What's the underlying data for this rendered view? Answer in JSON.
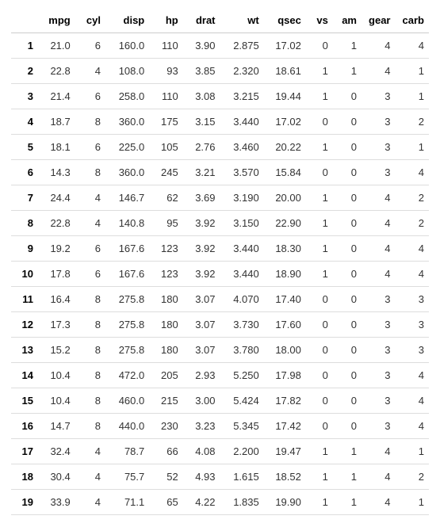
{
  "chart_data": {
    "type": "table",
    "title": "",
    "columns": [
      "mpg",
      "cyl",
      "disp",
      "hp",
      "drat",
      "wt",
      "qsec",
      "vs",
      "am",
      "gear",
      "carb"
    ],
    "index": [
      "1",
      "2",
      "3",
      "4",
      "5",
      "6",
      "7",
      "8",
      "9",
      "10",
      "11",
      "12",
      "13",
      "14",
      "15",
      "16",
      "17",
      "18",
      "19"
    ],
    "rows": [
      {
        "mpg": "21.0",
        "cyl": "6",
        "disp": "160.0",
        "hp": "110",
        "drat": "3.90",
        "wt": "2.875",
        "qsec": "17.02",
        "vs": "0",
        "am": "1",
        "gear": "4",
        "carb": "4"
      },
      {
        "mpg": "22.8",
        "cyl": "4",
        "disp": "108.0",
        "hp": "93",
        "drat": "3.85",
        "wt": "2.320",
        "qsec": "18.61",
        "vs": "1",
        "am": "1",
        "gear": "4",
        "carb": "1"
      },
      {
        "mpg": "21.4",
        "cyl": "6",
        "disp": "258.0",
        "hp": "110",
        "drat": "3.08",
        "wt": "3.215",
        "qsec": "19.44",
        "vs": "1",
        "am": "0",
        "gear": "3",
        "carb": "1"
      },
      {
        "mpg": "18.7",
        "cyl": "8",
        "disp": "360.0",
        "hp": "175",
        "drat": "3.15",
        "wt": "3.440",
        "qsec": "17.02",
        "vs": "0",
        "am": "0",
        "gear": "3",
        "carb": "2"
      },
      {
        "mpg": "18.1",
        "cyl": "6",
        "disp": "225.0",
        "hp": "105",
        "drat": "2.76",
        "wt": "3.460",
        "qsec": "20.22",
        "vs": "1",
        "am": "0",
        "gear": "3",
        "carb": "1"
      },
      {
        "mpg": "14.3",
        "cyl": "8",
        "disp": "360.0",
        "hp": "245",
        "drat": "3.21",
        "wt": "3.570",
        "qsec": "15.84",
        "vs": "0",
        "am": "0",
        "gear": "3",
        "carb": "4"
      },
      {
        "mpg": "24.4",
        "cyl": "4",
        "disp": "146.7",
        "hp": "62",
        "drat": "3.69",
        "wt": "3.190",
        "qsec": "20.00",
        "vs": "1",
        "am": "0",
        "gear": "4",
        "carb": "2"
      },
      {
        "mpg": "22.8",
        "cyl": "4",
        "disp": "140.8",
        "hp": "95",
        "drat": "3.92",
        "wt": "3.150",
        "qsec": "22.90",
        "vs": "1",
        "am": "0",
        "gear": "4",
        "carb": "2"
      },
      {
        "mpg": "19.2",
        "cyl": "6",
        "disp": "167.6",
        "hp": "123",
        "drat": "3.92",
        "wt": "3.440",
        "qsec": "18.30",
        "vs": "1",
        "am": "0",
        "gear": "4",
        "carb": "4"
      },
      {
        "mpg": "17.8",
        "cyl": "6",
        "disp": "167.6",
        "hp": "123",
        "drat": "3.92",
        "wt": "3.440",
        "qsec": "18.90",
        "vs": "1",
        "am": "0",
        "gear": "4",
        "carb": "4"
      },
      {
        "mpg": "16.4",
        "cyl": "8",
        "disp": "275.8",
        "hp": "180",
        "drat": "3.07",
        "wt": "4.070",
        "qsec": "17.40",
        "vs": "0",
        "am": "0",
        "gear": "3",
        "carb": "3"
      },
      {
        "mpg": "17.3",
        "cyl": "8",
        "disp": "275.8",
        "hp": "180",
        "drat": "3.07",
        "wt": "3.730",
        "qsec": "17.60",
        "vs": "0",
        "am": "0",
        "gear": "3",
        "carb": "3"
      },
      {
        "mpg": "15.2",
        "cyl": "8",
        "disp": "275.8",
        "hp": "180",
        "drat": "3.07",
        "wt": "3.780",
        "qsec": "18.00",
        "vs": "0",
        "am": "0",
        "gear": "3",
        "carb": "3"
      },
      {
        "mpg": "10.4",
        "cyl": "8",
        "disp": "472.0",
        "hp": "205",
        "drat": "2.93",
        "wt": "5.250",
        "qsec": "17.98",
        "vs": "0",
        "am": "0",
        "gear": "3",
        "carb": "4"
      },
      {
        "mpg": "10.4",
        "cyl": "8",
        "disp": "460.0",
        "hp": "215",
        "drat": "3.00",
        "wt": "5.424",
        "qsec": "17.82",
        "vs": "0",
        "am": "0",
        "gear": "3",
        "carb": "4"
      },
      {
        "mpg": "14.7",
        "cyl": "8",
        "disp": "440.0",
        "hp": "230",
        "drat": "3.23",
        "wt": "5.345",
        "qsec": "17.42",
        "vs": "0",
        "am": "0",
        "gear": "3",
        "carb": "4"
      },
      {
        "mpg": "32.4",
        "cyl": "4",
        "disp": "78.7",
        "hp": "66",
        "drat": "4.08",
        "wt": "2.200",
        "qsec": "19.47",
        "vs": "1",
        "am": "1",
        "gear": "4",
        "carb": "1"
      },
      {
        "mpg": "30.4",
        "cyl": "4",
        "disp": "75.7",
        "hp": "52",
        "drat": "4.93",
        "wt": "1.615",
        "qsec": "18.52",
        "vs": "1",
        "am": "1",
        "gear": "4",
        "carb": "2"
      },
      {
        "mpg": "33.9",
        "cyl": "4",
        "disp": "71.1",
        "hp": "65",
        "drat": "4.22",
        "wt": "1.835",
        "qsec": "19.90",
        "vs": "1",
        "am": "1",
        "gear": "4",
        "carb": "1"
      }
    ]
  }
}
